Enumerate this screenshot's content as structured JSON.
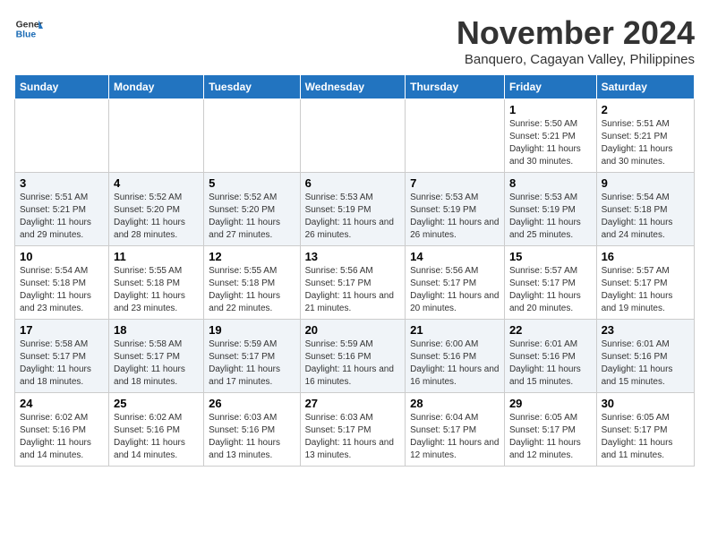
{
  "header": {
    "logo_general": "General",
    "logo_blue": "Blue",
    "month": "November 2024",
    "location": "Banquero, Cagayan Valley, Philippines"
  },
  "weekdays": [
    "Sunday",
    "Monday",
    "Tuesday",
    "Wednesday",
    "Thursday",
    "Friday",
    "Saturday"
  ],
  "weeks": [
    [
      {
        "day": "",
        "info": ""
      },
      {
        "day": "",
        "info": ""
      },
      {
        "day": "",
        "info": ""
      },
      {
        "day": "",
        "info": ""
      },
      {
        "day": "",
        "info": ""
      },
      {
        "day": "1",
        "info": "Sunrise: 5:50 AM\nSunset: 5:21 PM\nDaylight: 11 hours and 30 minutes."
      },
      {
        "day": "2",
        "info": "Sunrise: 5:51 AM\nSunset: 5:21 PM\nDaylight: 11 hours and 30 minutes."
      }
    ],
    [
      {
        "day": "3",
        "info": "Sunrise: 5:51 AM\nSunset: 5:21 PM\nDaylight: 11 hours and 29 minutes."
      },
      {
        "day": "4",
        "info": "Sunrise: 5:52 AM\nSunset: 5:20 PM\nDaylight: 11 hours and 28 minutes."
      },
      {
        "day": "5",
        "info": "Sunrise: 5:52 AM\nSunset: 5:20 PM\nDaylight: 11 hours and 27 minutes."
      },
      {
        "day": "6",
        "info": "Sunrise: 5:53 AM\nSunset: 5:19 PM\nDaylight: 11 hours and 26 minutes."
      },
      {
        "day": "7",
        "info": "Sunrise: 5:53 AM\nSunset: 5:19 PM\nDaylight: 11 hours and 26 minutes."
      },
      {
        "day": "8",
        "info": "Sunrise: 5:53 AM\nSunset: 5:19 PM\nDaylight: 11 hours and 25 minutes."
      },
      {
        "day": "9",
        "info": "Sunrise: 5:54 AM\nSunset: 5:18 PM\nDaylight: 11 hours and 24 minutes."
      }
    ],
    [
      {
        "day": "10",
        "info": "Sunrise: 5:54 AM\nSunset: 5:18 PM\nDaylight: 11 hours and 23 minutes."
      },
      {
        "day": "11",
        "info": "Sunrise: 5:55 AM\nSunset: 5:18 PM\nDaylight: 11 hours and 23 minutes."
      },
      {
        "day": "12",
        "info": "Sunrise: 5:55 AM\nSunset: 5:18 PM\nDaylight: 11 hours and 22 minutes."
      },
      {
        "day": "13",
        "info": "Sunrise: 5:56 AM\nSunset: 5:17 PM\nDaylight: 11 hours and 21 minutes."
      },
      {
        "day": "14",
        "info": "Sunrise: 5:56 AM\nSunset: 5:17 PM\nDaylight: 11 hours and 20 minutes."
      },
      {
        "day": "15",
        "info": "Sunrise: 5:57 AM\nSunset: 5:17 PM\nDaylight: 11 hours and 20 minutes."
      },
      {
        "day": "16",
        "info": "Sunrise: 5:57 AM\nSunset: 5:17 PM\nDaylight: 11 hours and 19 minutes."
      }
    ],
    [
      {
        "day": "17",
        "info": "Sunrise: 5:58 AM\nSunset: 5:17 PM\nDaylight: 11 hours and 18 minutes."
      },
      {
        "day": "18",
        "info": "Sunrise: 5:58 AM\nSunset: 5:17 PM\nDaylight: 11 hours and 18 minutes."
      },
      {
        "day": "19",
        "info": "Sunrise: 5:59 AM\nSunset: 5:17 PM\nDaylight: 11 hours and 17 minutes."
      },
      {
        "day": "20",
        "info": "Sunrise: 5:59 AM\nSunset: 5:16 PM\nDaylight: 11 hours and 16 minutes."
      },
      {
        "day": "21",
        "info": "Sunrise: 6:00 AM\nSunset: 5:16 PM\nDaylight: 11 hours and 16 minutes."
      },
      {
        "day": "22",
        "info": "Sunrise: 6:01 AM\nSunset: 5:16 PM\nDaylight: 11 hours and 15 minutes."
      },
      {
        "day": "23",
        "info": "Sunrise: 6:01 AM\nSunset: 5:16 PM\nDaylight: 11 hours and 15 minutes."
      }
    ],
    [
      {
        "day": "24",
        "info": "Sunrise: 6:02 AM\nSunset: 5:16 PM\nDaylight: 11 hours and 14 minutes."
      },
      {
        "day": "25",
        "info": "Sunrise: 6:02 AM\nSunset: 5:16 PM\nDaylight: 11 hours and 14 minutes."
      },
      {
        "day": "26",
        "info": "Sunrise: 6:03 AM\nSunset: 5:16 PM\nDaylight: 11 hours and 13 minutes."
      },
      {
        "day": "27",
        "info": "Sunrise: 6:03 AM\nSunset: 5:17 PM\nDaylight: 11 hours and 13 minutes."
      },
      {
        "day": "28",
        "info": "Sunrise: 6:04 AM\nSunset: 5:17 PM\nDaylight: 11 hours and 12 minutes."
      },
      {
        "day": "29",
        "info": "Sunrise: 6:05 AM\nSunset: 5:17 PM\nDaylight: 11 hours and 12 minutes."
      },
      {
        "day": "30",
        "info": "Sunrise: 6:05 AM\nSunset: 5:17 PM\nDaylight: 11 hours and 11 minutes."
      }
    ]
  ]
}
